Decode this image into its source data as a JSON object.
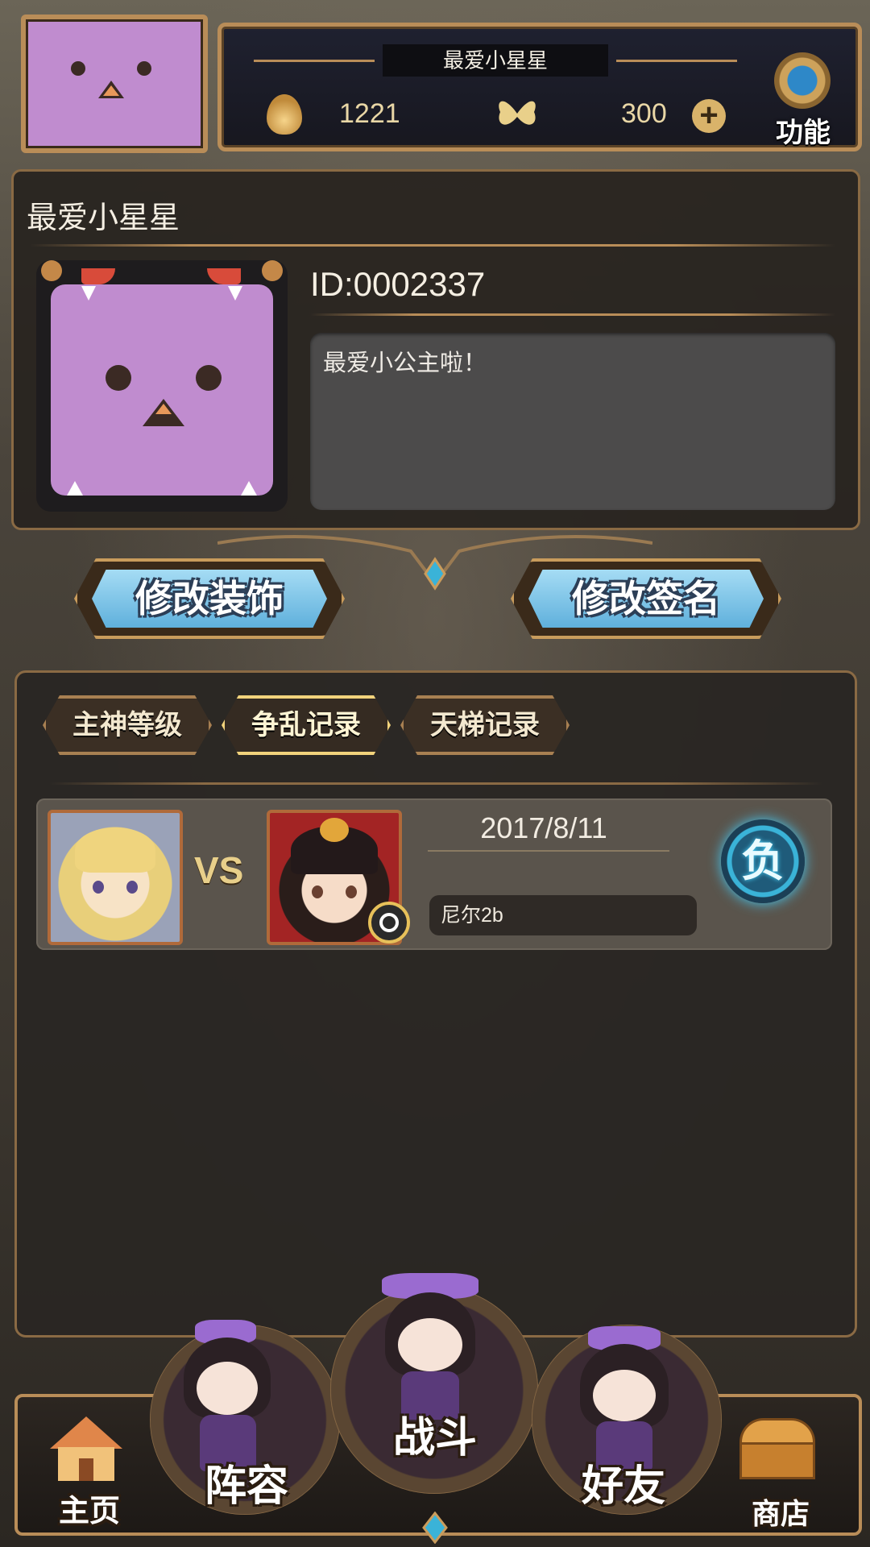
{
  "header": {
    "player_name": "最爱小星星",
    "stamina_value": "1221",
    "currency_value": "300",
    "function_label": "功能"
  },
  "profile": {
    "name": "最爱小星星",
    "id_text": "ID:0002337",
    "signature": "最爱小公主啦！"
  },
  "actions": {
    "edit_decoration": "修改装饰",
    "edit_signature": "修改签名"
  },
  "tabs": [
    {
      "label": "主神等级",
      "active": false
    },
    {
      "label": "争乱记录",
      "active": true
    },
    {
      "label": "天梯记录",
      "active": false
    }
  ],
  "records": [
    {
      "vs_text": "VS",
      "date": "2017/8/11",
      "opponent_name": "尼尔2b",
      "result": "负"
    }
  ],
  "bottom_nav": {
    "home": "主页",
    "team": "阵容",
    "battle": "战斗",
    "friends": "好友",
    "shop": "商店"
  },
  "colors": {
    "accent_gold": "#b98d58",
    "button_blue": "#5fb0dc",
    "avatar_purple": "#c08ccf",
    "result_glow": "#44c8f2"
  }
}
